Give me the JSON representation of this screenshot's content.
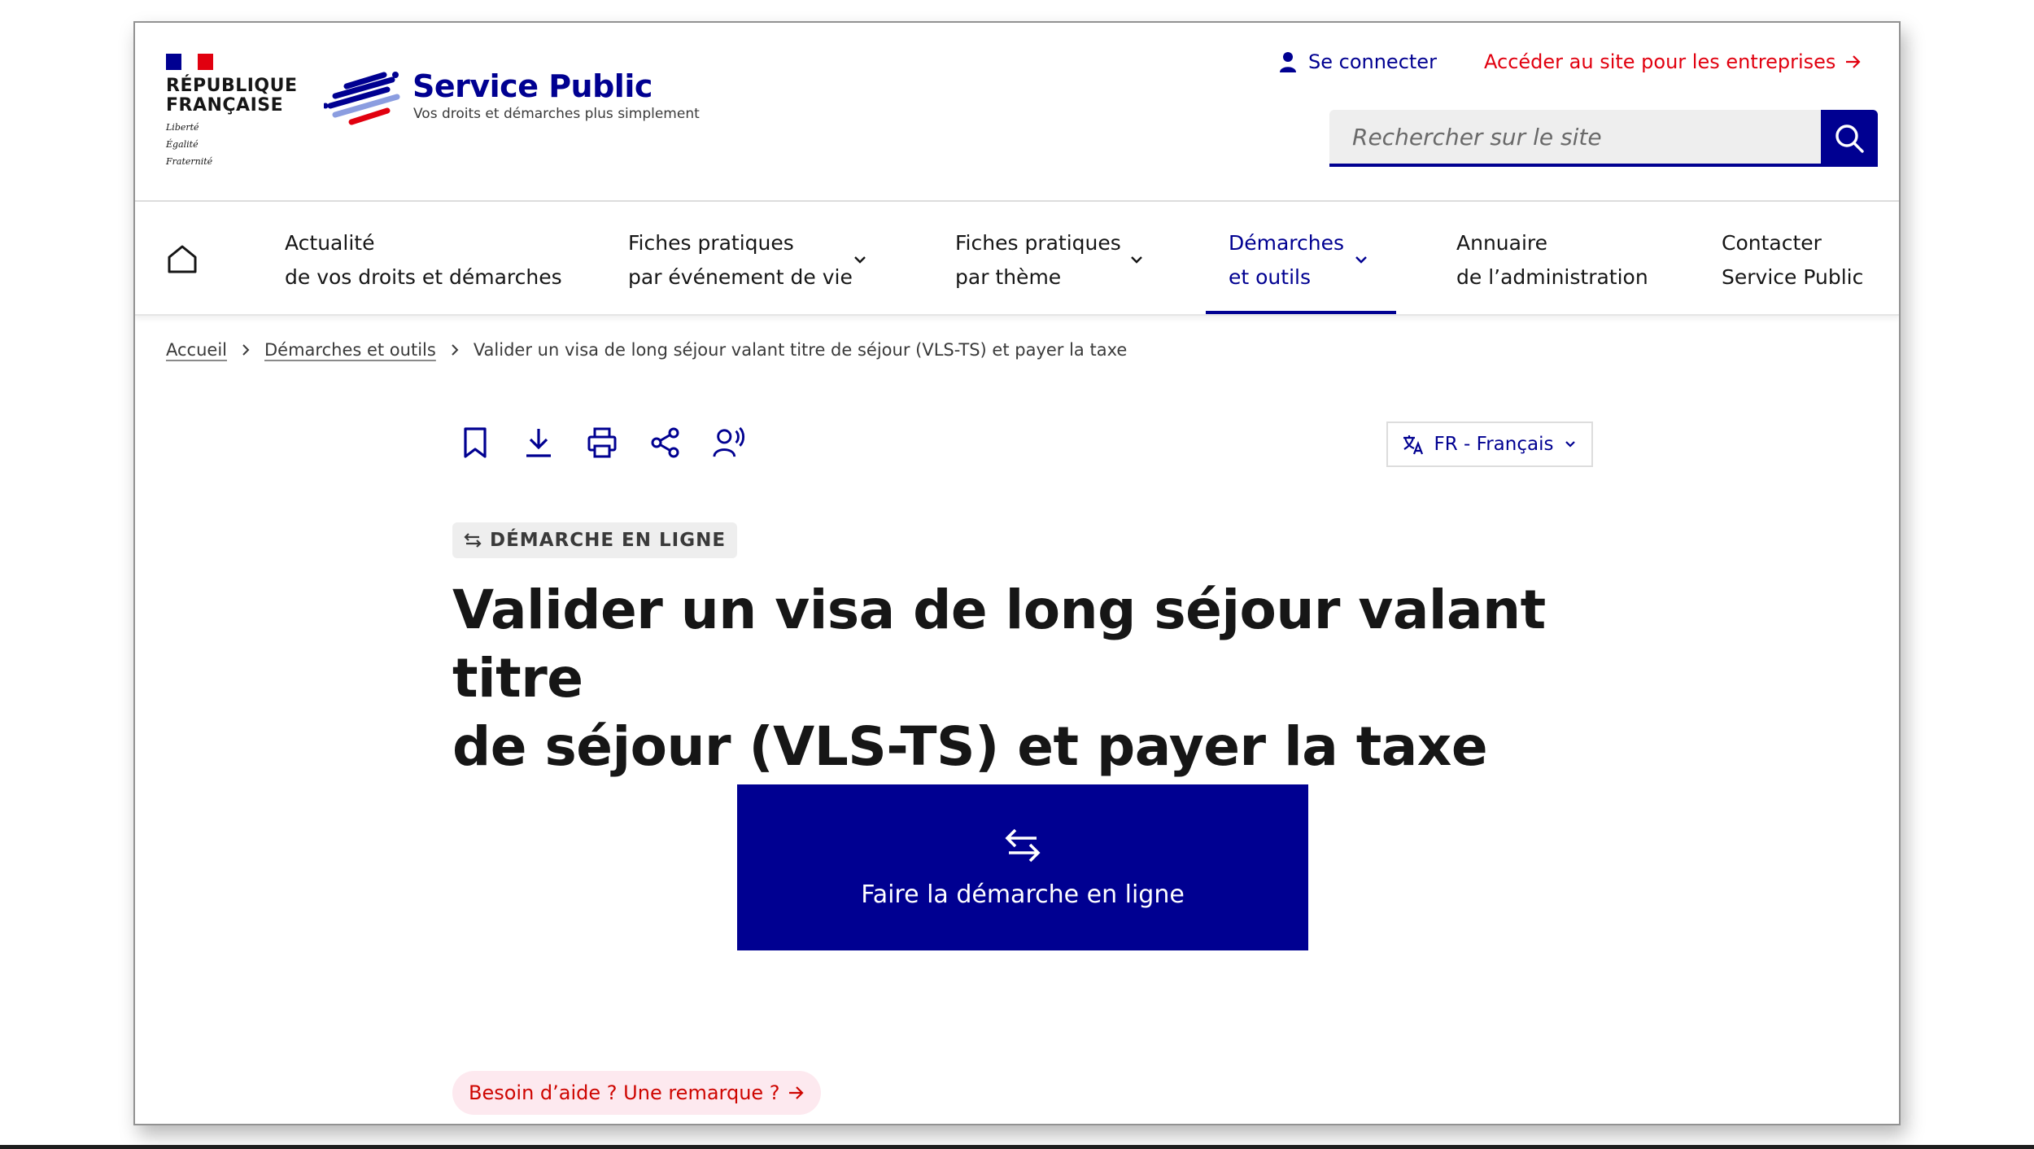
{
  "header": {
    "republique_line1": "RÉPUBLIQUE",
    "republique_line2": "FRANÇAISE",
    "devise_1": "Liberté",
    "devise_2": "Égalité",
    "devise_3": "Fraternité",
    "site_title": "Service Public",
    "site_tagline": "Vos droits et démarches plus simplement",
    "login_label": "Se connecter",
    "enterprise_link": "Accéder au site pour les entreprises",
    "search_placeholder": "Rechercher sur le site"
  },
  "nav": {
    "items": [
      {
        "line1": "Actualité",
        "line2": "de vos droits et démarches",
        "has_chevron": false,
        "active": false
      },
      {
        "line1": "Fiches pratiques",
        "line2": "par événement de vie",
        "has_chevron": true,
        "active": false
      },
      {
        "line1": "Fiches pratiques",
        "line2": "par thème",
        "has_chevron": true,
        "active": false
      },
      {
        "line1": "Démarches",
        "line2": "et outils",
        "has_chevron": true,
        "active": true
      },
      {
        "line1": "Annuaire",
        "line2": "de l’administration",
        "has_chevron": false,
        "active": false
      },
      {
        "line1": "Contacter",
        "line2": "Service Public",
        "has_chevron": false,
        "active": false
      }
    ]
  },
  "breadcrumb": {
    "home": "Accueil",
    "section": "Démarches et outils",
    "current": "Valider un visa de long séjour valant titre de séjour (VLS-TS) et payer la taxe"
  },
  "language": {
    "selected": "FR - Français"
  },
  "badge": {
    "label": "DÉMARCHE EN LIGNE"
  },
  "title": {
    "line1": "Valider un visa de long séjour valant titre",
    "line2": "de séjour (VLS-TS) et payer la taxe"
  },
  "cta": {
    "label": "Faire la démarche en ligne"
  },
  "help": {
    "label": "Besoin d’aide ? Une remarque ?"
  },
  "colors": {
    "primary": "#000091",
    "marianne_red": "#e1000f",
    "help_text": "#ce0500",
    "help_bg": "#fde9ef"
  },
  "icons": {
    "search": "search-icon",
    "user": "user-icon",
    "home": "home-icon",
    "bookmark": "bookmark-icon",
    "download": "download-icon",
    "print": "print-icon",
    "share": "share-icon",
    "listen": "listen-icon",
    "translate": "translate-icon",
    "swap": "swap-arrows-icon"
  }
}
